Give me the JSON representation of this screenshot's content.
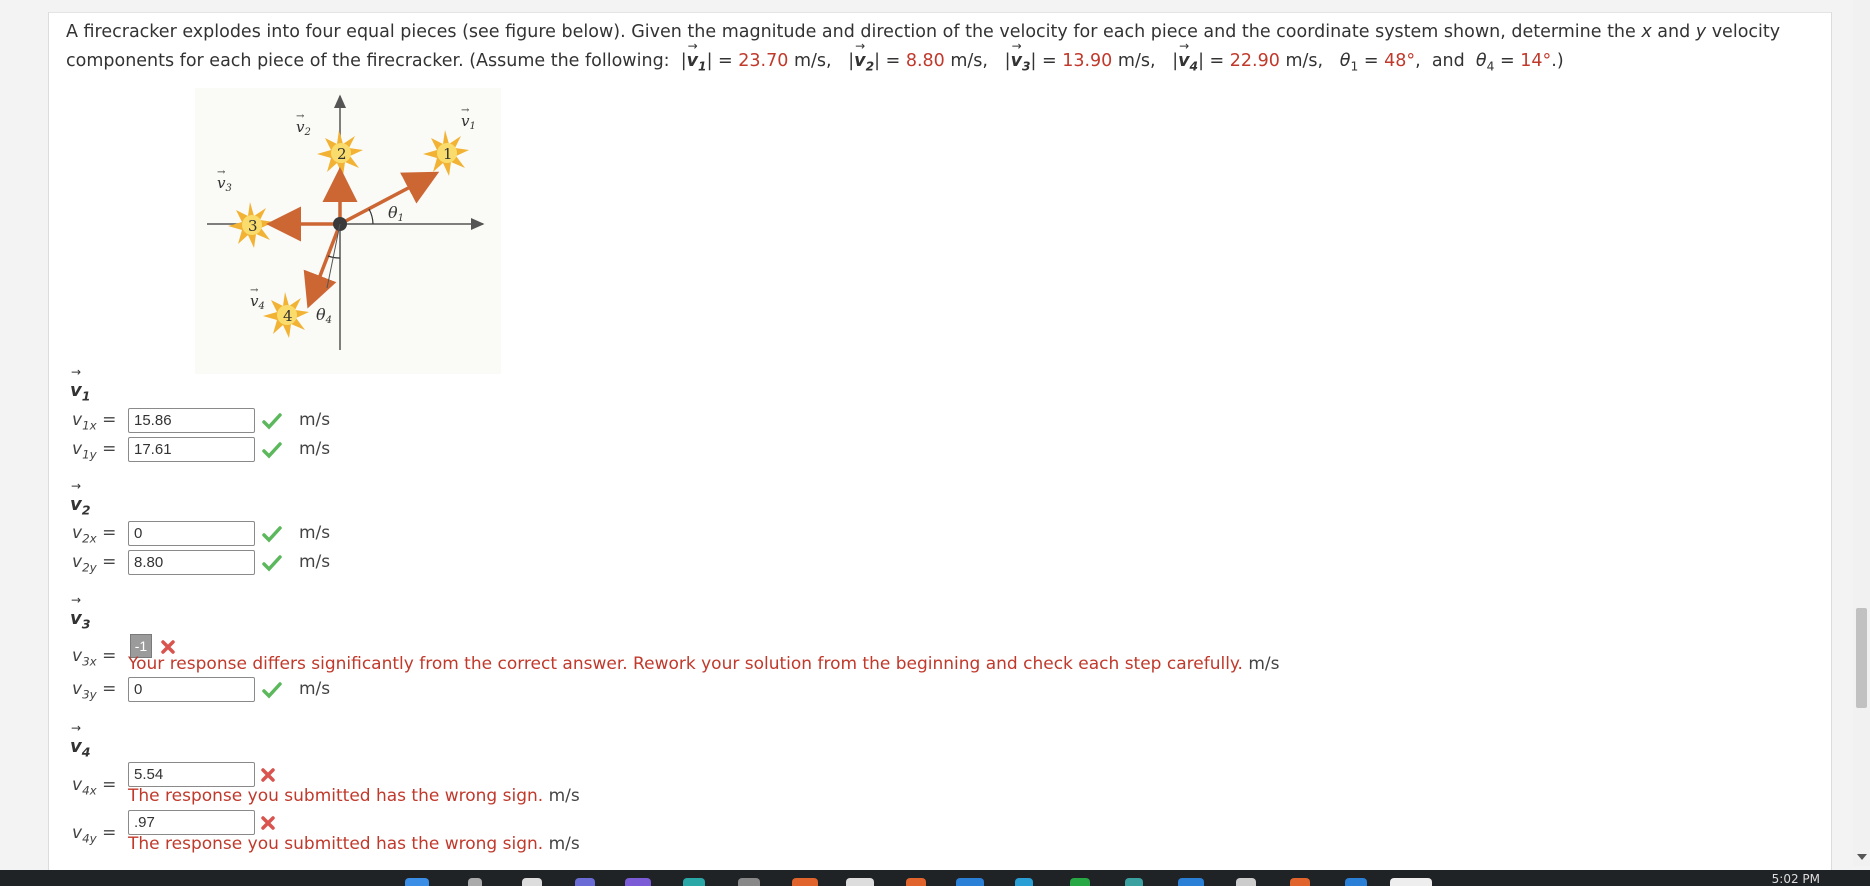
{
  "question": {
    "intro": "A firecracker explodes into four equal pieces (see figure below). Given the magnitude and direction of the velocity for each piece and the coordinate system shown, determine the ",
    "x_var": "x",
    "and": " and ",
    "y_var": "y",
    "rest": " velocity components for each piece of the firecracker. (Assume the following: ",
    "v1_mag": "23.70",
    "v2_mag": "8.80",
    "v3_mag": "13.90",
    "v4_mag": "22.90",
    "theta1": "48",
    "theta4": "14",
    "ms": "m/s",
    "deg": "°",
    "and_word": "and"
  },
  "figure": {
    "labels": {
      "v1": "v",
      "v2": "v",
      "v3": "v",
      "v4": "v",
      "theta1": "θ",
      "theta4": "θ"
    },
    "pieces": [
      "1",
      "2",
      "3",
      "4"
    ],
    "colors": {
      "arrow": "#cc6633",
      "axis": "#555555",
      "star_outer": "#f2b233",
      "star_inner": "#f9dc6b"
    }
  },
  "vectors": [
    {
      "heading": "v",
      "sub": "1",
      "rows": [
        {
          "var": "v",
          "sub": "1x",
          "value": "15.86",
          "status": "correct",
          "unit": "m/s"
        },
        {
          "var": "v",
          "sub": "1y",
          "value": "17.61",
          "status": "correct",
          "unit": "m/s"
        }
      ]
    },
    {
      "heading": "v",
      "sub": "2",
      "rows": [
        {
          "var": "v",
          "sub": "2x",
          "value": "0",
          "status": "correct",
          "unit": "m/s"
        },
        {
          "var": "v",
          "sub": "2y",
          "value": "8.80",
          "status": "correct",
          "unit": "m/s"
        }
      ]
    },
    {
      "heading": "v",
      "sub": "3",
      "rows": [
        {
          "var": "v",
          "sub": "3x",
          "value": "-1",
          "status": "wrong",
          "feedback": "Your response differs significantly from the correct answer. Rework your solution from the beginning and check each step carefully.",
          "unit": "m/s"
        },
        {
          "var": "v",
          "sub": "3y",
          "value": "0",
          "status": "correct",
          "unit": "m/s"
        }
      ]
    },
    {
      "heading": "v",
      "sub": "4",
      "rows": [
        {
          "var": "v",
          "sub": "4x",
          "value": "5.54",
          "status": "wrong",
          "feedback": "The response you submitted has the wrong sign.",
          "unit": "m/s"
        },
        {
          "var": "v",
          "sub": "4y",
          "value": ".97",
          "status": "wrong",
          "feedback": "The response you submitted has the wrong sign.",
          "unit": "m/s"
        }
      ]
    }
  ],
  "colors": {
    "correct": "#5cb85c",
    "wrong": "#d9534f",
    "red_text": "#c0392b"
  },
  "icons": {
    "correct": "check-icon",
    "wrong": "cross-icon"
  },
  "clock": "5:02 PM"
}
